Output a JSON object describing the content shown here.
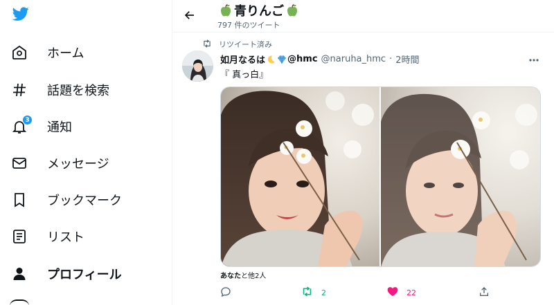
{
  "colors": {
    "accent": "#1d9bf0",
    "retweet": "#00ba7c",
    "like": "#f91880",
    "text": "#0f1419",
    "muted": "#536471"
  },
  "sidebar": {
    "logo_icon": "twitter-bird-icon",
    "items": [
      {
        "label": "ホーム",
        "icon": "home-icon"
      },
      {
        "label": "話題を検索",
        "icon": "hashtag-icon"
      },
      {
        "label": "通知",
        "icon": "bell-icon",
        "badge": "3"
      },
      {
        "label": "メッセージ",
        "icon": "envelope-icon"
      },
      {
        "label": "ブックマーク",
        "icon": "bookmark-icon"
      },
      {
        "label": "リスト",
        "icon": "list-icon"
      },
      {
        "label": "プロフィール",
        "icon": "person-icon",
        "active": true
      }
    ]
  },
  "header": {
    "title": "青りんご",
    "subtitle": "797 件のツイート"
  },
  "tweet": {
    "retweet_label": "リツイート済み",
    "name": "如月なるは",
    "name_suffix": "@hmc",
    "handle": "@naruha_hmc",
    "separator": "·",
    "time": "2時間",
    "text": "『 真っ白』",
    "likers_bold": "あなた",
    "likers_rest": "と他2人",
    "actions": {
      "reply_count": "",
      "retweet_count": "2",
      "like_count": "22",
      "share_count": ""
    }
  }
}
